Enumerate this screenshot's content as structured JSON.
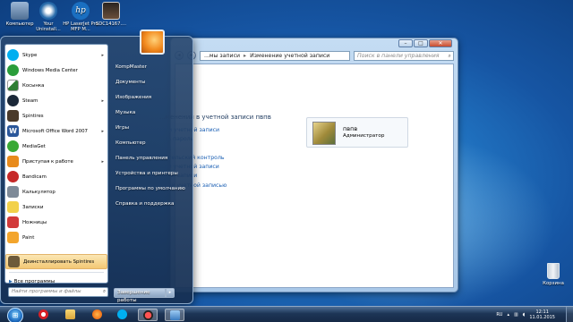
{
  "desktop": {
    "icons": [
      {
        "label": "Компьютер",
        "color": "#6e8fb4"
      },
      {
        "label": "Your Uninstall...",
        "color": "#2468a8"
      },
      {
        "label": "HP LaserJet Pro MFP M...",
        "color": "#1a6fc1"
      },
      {
        "label": "SDC14167....",
        "color": "#3b2b22"
      }
    ],
    "recycle_bin": "Корзина"
  },
  "window": {
    "address": [
      "...мы записи",
      "Изменение учетной записи"
    ],
    "search_placeholder": "Поиск в панели управления",
    "title": "...менений в учетной записи пвпв",
    "links": [
      "...ни учетной записи",
      "...ть пароль",
      "...ок",
      "...ительский контроль",
      "...ой учетной записи",
      "...ной записи",
      "...вой учетной записью"
    ],
    "user": {
      "name": "пвпв",
      "role": "Администратор"
    }
  },
  "start_menu": {
    "programs": [
      {
        "label": "Skype",
        "color": "#00aff0",
        "arrow": true
      },
      {
        "label": "Windows Media Center",
        "color": "#2a9d3a",
        "arrow": false
      },
      {
        "label": "Косынка",
        "color": "#2e7d32",
        "arrow": false
      },
      {
        "label": "Steam",
        "color": "#1b2838",
        "arrow": true
      },
      {
        "label": "Spintires",
        "color": "#4a3a2a",
        "arrow": false
      },
      {
        "label": "Microsoft Office Word 2007",
        "color": "#2b579a",
        "arrow": true
      },
      {
        "label": "MediaGet",
        "color": "#39a935",
        "arrow": false
      },
      {
        "label": "Приступая к работе",
        "color": "#e88b1c",
        "arrow": true
      },
      {
        "label": "Bandicam",
        "color": "#c62828",
        "arrow": false
      },
      {
        "label": "Калькулятор",
        "color": "#7e8a98",
        "arrow": false
      },
      {
        "label": "Записки",
        "color": "#f2d14a",
        "arrow": false
      },
      {
        "label": "Ножницы",
        "color": "#d23a3a",
        "arrow": false
      },
      {
        "label": "Paint",
        "color": "#f3a52c",
        "arrow": false
      },
      {
        "label": "Деинсталлировать Spintires",
        "color": "#6d5a3a",
        "arrow": false,
        "highlight": true
      }
    ],
    "all_programs": "Все программы",
    "search_placeholder": "Найти программы и файлы",
    "right_items": [
      "KompMaster",
      "Документы",
      "Изображения",
      "Музыка",
      "Игры",
      "Компьютер",
      "Панель управления",
      "Устройства и принтеры",
      "Программы по умолчанию",
      "Справка и поддержка"
    ],
    "shutdown": "Завершение работы"
  },
  "taskbar": {
    "language": "RU",
    "time": "12:11",
    "date": "11.01.2015"
  }
}
